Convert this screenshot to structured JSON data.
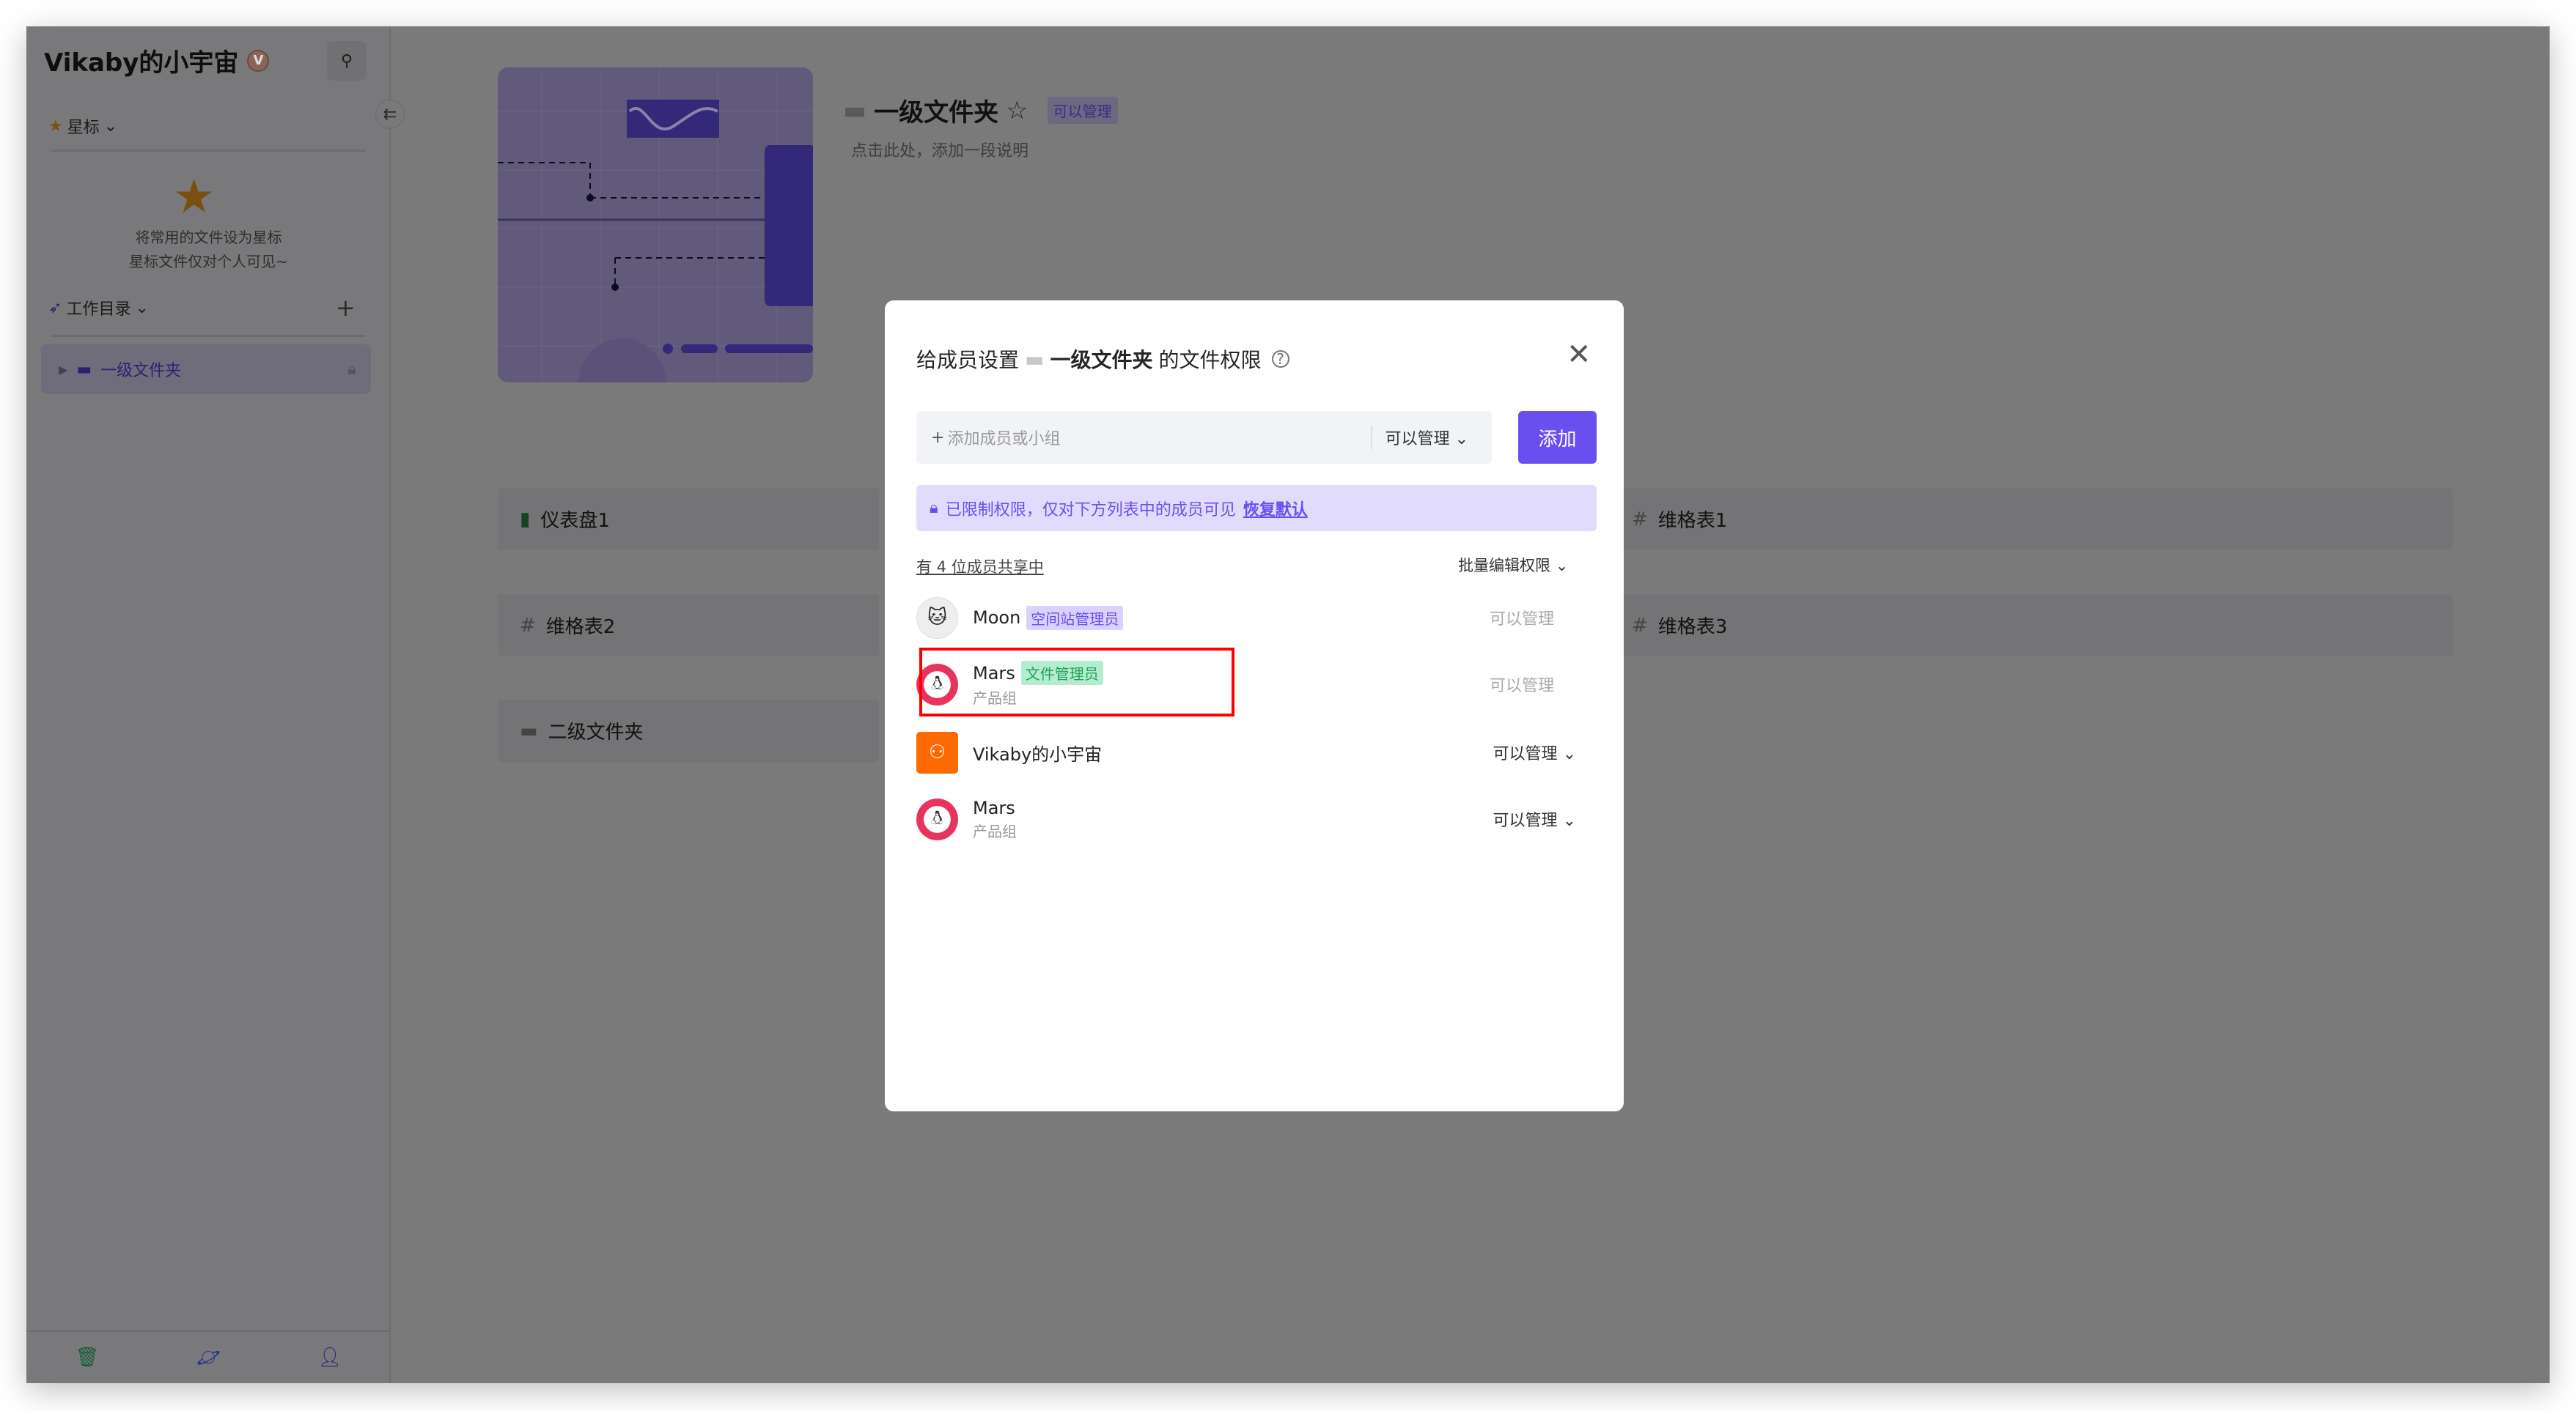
{
  "sidebar": {
    "workspace": "Vikaby的小宇宙",
    "workspace_badge": "V",
    "starred_label": "星标",
    "starred_empty": [
      "将常用的文件设为星标",
      "星标文件仅对个人可见~"
    ],
    "catalog_label": "工作目录",
    "items": [
      {
        "label": "一级文件夹",
        "locked": true
      }
    ]
  },
  "folder": {
    "title": "一级文件夹",
    "permission_tag": "可以管理",
    "description_placeholder": "点击此处，添加一段说明"
  },
  "cards": [
    {
      "label": "仪表盘1",
      "icon": "dashboard-icon"
    },
    {
      "label": "维格表1",
      "icon": "datasheet-icon"
    },
    {
      "label": "维格表2",
      "icon": "datasheet-icon"
    },
    {
      "label": "维格表3",
      "icon": "datasheet-icon"
    },
    {
      "label": "二级文件夹",
      "icon": "folder-icon"
    }
  ],
  "modal": {
    "title_prefix": "给成员设置",
    "title_folder": "一级文件夹",
    "title_suffix": "的文件权限",
    "add_placeholder": "添加成员或小组",
    "add_permission": "可以管理",
    "add_button": "添加",
    "notice": "已限制权限，仅对下方列表中的成员可见",
    "notice_link": "恢复默认",
    "share_count": "有 4 位成员共享中",
    "bulk_edit": "批量编辑权限",
    "members": [
      {
        "name": "Moon",
        "role": "空间站管理员",
        "team": "",
        "permission": "可以管理",
        "editable": false
      },
      {
        "name": "Mars",
        "role": "文件管理员",
        "team": "产品组",
        "permission": "可以管理",
        "editable": false
      },
      {
        "name": "Vikaby的小宇宙",
        "role": "",
        "team": "",
        "permission": "可以管理",
        "editable": true
      },
      {
        "name": "Mars",
        "role": "",
        "team": "产品组",
        "permission": "可以管理",
        "editable": true
      }
    ]
  },
  "colors": {
    "accent": "#6a4ff0",
    "highlight": "#ff0000",
    "team_avatar": "#ff6a00"
  }
}
